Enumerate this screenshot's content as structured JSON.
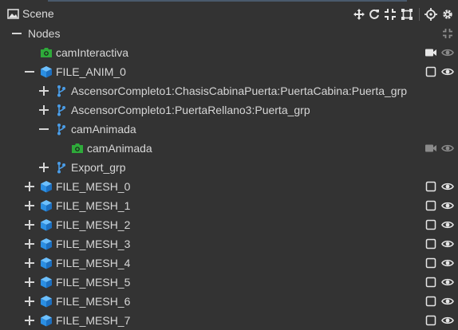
{
  "header": {
    "title": "Scene",
    "icons": [
      "image-icon",
      "move-icon",
      "refresh-icon",
      "collapse-icon",
      "frame-icon",
      "target-icon",
      "settings-icon"
    ]
  },
  "tree": {
    "root_label": "Nodes",
    "items": [
      {
        "label": "camInteractiva",
        "icon": "camera-icon",
        "toggle": "none"
      },
      {
        "label": "FILE_ANIM_0",
        "icon": "cube-icon",
        "toggle": "minus"
      },
      {
        "label": "AscensorCompleto1:ChasisCabinaPuerta:PuertaCabina:Puerta_grp",
        "icon": "branch-icon",
        "toggle": "plus"
      },
      {
        "label": "AscensorCompleto1:PuertaRellano3:Puerta_grp",
        "icon": "branch-icon",
        "toggle": "plus"
      },
      {
        "label": "camAnimada",
        "icon": "branch-icon",
        "toggle": "minus"
      },
      {
        "label": "camAnimada",
        "icon": "camera-icon",
        "toggle": "none"
      },
      {
        "label": "Export_grp",
        "icon": "branch-icon",
        "toggle": "plus"
      },
      {
        "label": "FILE_MESH_0",
        "icon": "cube-icon",
        "toggle": "plus"
      },
      {
        "label": "FILE_MESH_1",
        "icon": "cube-icon",
        "toggle": "plus"
      },
      {
        "label": "FILE_MESH_2",
        "icon": "cube-icon",
        "toggle": "plus"
      },
      {
        "label": "FILE_MESH_3",
        "icon": "cube-icon",
        "toggle": "plus"
      },
      {
        "label": "FILE_MESH_4",
        "icon": "cube-icon",
        "toggle": "plus"
      },
      {
        "label": "FILE_MESH_5",
        "icon": "cube-icon",
        "toggle": "plus"
      },
      {
        "label": "FILE_MESH_6",
        "icon": "cube-icon",
        "toggle": "plus"
      },
      {
        "label": "FILE_MESH_7",
        "icon": "cube-icon",
        "toggle": "plus"
      }
    ]
  },
  "colors": {
    "background": "#333333",
    "text": "#d6d6d6",
    "camera_green": "#2eaa3a",
    "cube_blue": "#2b8fe3",
    "branch_blue": "#4a9de8",
    "icon_light": "#e6e6e6",
    "icon_dim": "#8a8a8a"
  }
}
